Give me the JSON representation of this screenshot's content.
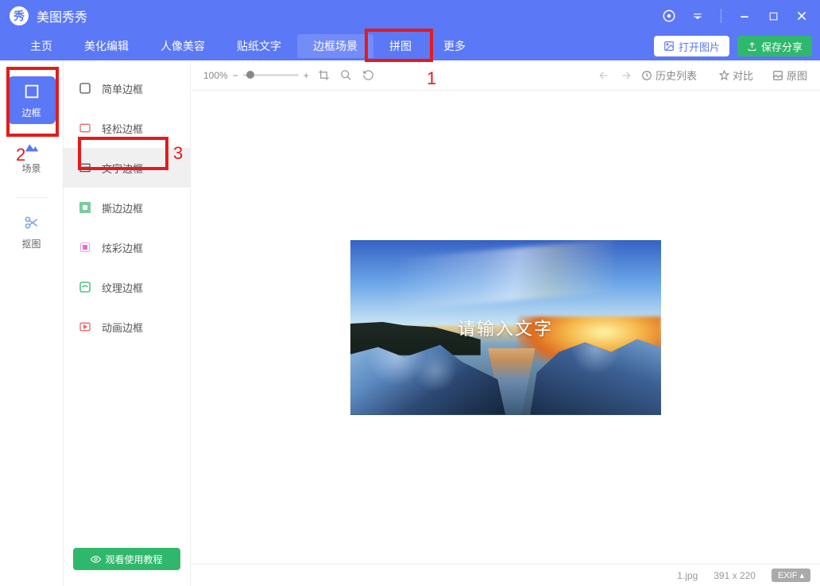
{
  "titlebar": {
    "title": "美图秀秀"
  },
  "nav": {
    "items": [
      "主页",
      "美化编辑",
      "人像美容",
      "贴纸文字",
      "边框场景",
      "拼图",
      "更多"
    ],
    "open_label": "打开图片",
    "save_label": "保存分享"
  },
  "sidebar": {
    "items": [
      {
        "label": "边框"
      },
      {
        "label": "场景"
      },
      {
        "label": "抠图"
      }
    ]
  },
  "panel": {
    "items": [
      "简单边框",
      "轻松边框",
      "文字边框",
      "撕边边框",
      "炫彩边框",
      "纹理边框",
      "动画边框"
    ],
    "tutorial_label": "观看使用教程"
  },
  "toolbar": {
    "zoom": "100%",
    "history_label": "历史列表",
    "compare_label": "对比",
    "original_label": "原图"
  },
  "canvas": {
    "placeholder_text": "请输入文字"
  },
  "statusbar": {
    "filename": "1.jpg",
    "dimensions": "391 x 220",
    "exif_label": "EXIF ▴"
  },
  "annotations": {
    "a1": "1",
    "a2": "2",
    "a3": "3"
  }
}
